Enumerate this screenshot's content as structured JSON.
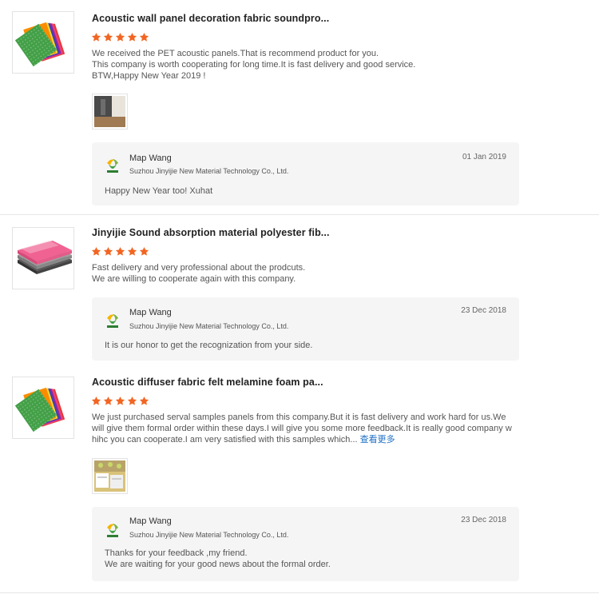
{
  "reviews": [
    {
      "title": "Acoustic wall panel decoration fabric soundpro...",
      "rating": 5,
      "text": "We received the PET acoustic panels.That is recommend product for you.\nThis company is worth cooperating for long time.It is fast delivery and good service.\nBTW,Happy New Year 2019 !",
      "more_label": "",
      "reply": {
        "name": "Map Wang",
        "company": "Suzhou Jinyijie New Material Technology Co., Ltd.",
        "date": "01 Jan 2019",
        "message": "Happy New Year too! Xuhat"
      }
    },
    {
      "title": "Jinyijie Sound absorption material polyester fib...",
      "rating": 5,
      "text": "Fast delivery and very professional about the prodcuts.\nWe are willing to cooperate again with this company.",
      "more_label": "",
      "reply": {
        "name": "Map Wang",
        "company": "Suzhou Jinyijie New Material Technology Co., Ltd.",
        "date": "23 Dec 2018",
        "message": "It is our honor to get the recognization from your side."
      }
    },
    {
      "title": "Acoustic diffuser fabric felt melamine foam pa...",
      "rating": 5,
      "text": "We just purchased serval samples panels from this company.But it is fast delivery and work hard for us.We\nwill give them formal order within these days.I will give you some more feedback.It is really good company w\nhihc you can cooperate.I am very satisfied with this samples which... ",
      "more_label": "查看更多",
      "reply": {
        "name": "Map Wang",
        "company": "Suzhou Jinyijie New Material Technology Co., Ltd.",
        "date": "23 Dec 2018",
        "message": "Thanks for your feedback ,my friend.\nWe are waiting for your good news about the formal order."
      }
    }
  ],
  "colors": {
    "star": "#f26522",
    "link": "#1f6fc5",
    "reply_bg": "#f5f5f5"
  },
  "icons": {
    "rating": "star-icon",
    "logo": "jinyijie-logo-icon"
  }
}
